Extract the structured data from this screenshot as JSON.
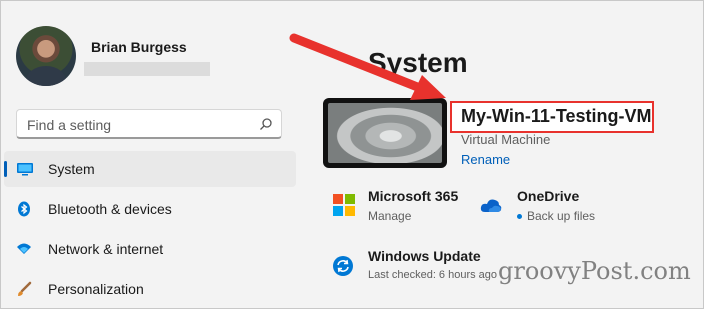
{
  "user": {
    "name": "Brian Burgess"
  },
  "search": {
    "placeholder": "Find a setting"
  },
  "nav": {
    "items": [
      {
        "label": "System",
        "icon": "monitor-icon",
        "selected": true
      },
      {
        "label": "Bluetooth & devices",
        "icon": "bluetooth-icon",
        "selected": false
      },
      {
        "label": "Network & internet",
        "icon": "wifi-icon",
        "selected": false
      },
      {
        "label": "Personalization",
        "icon": "brush-icon",
        "selected": false
      }
    ]
  },
  "main": {
    "title": "System",
    "device": {
      "name": "My-Win-11-Testing-VM",
      "type": "Virtual Machine",
      "rename_label": "Rename"
    },
    "tiles": [
      {
        "title": "Microsoft 365",
        "sub": "Manage",
        "icon": "microsoft-logo-icon"
      },
      {
        "title": "OneDrive",
        "sub": "Back up files",
        "icon": "onedrive-cloud-icon"
      },
      {
        "title": "Windows Update",
        "sub": "Last checked: 6 hours ago",
        "icon": "windows-update-icon"
      }
    ]
  },
  "watermark": "groovyPost.com",
  "colors": {
    "accent": "#005fb8",
    "highlight_box": "#e8322d",
    "arrow": "#e8322d"
  }
}
